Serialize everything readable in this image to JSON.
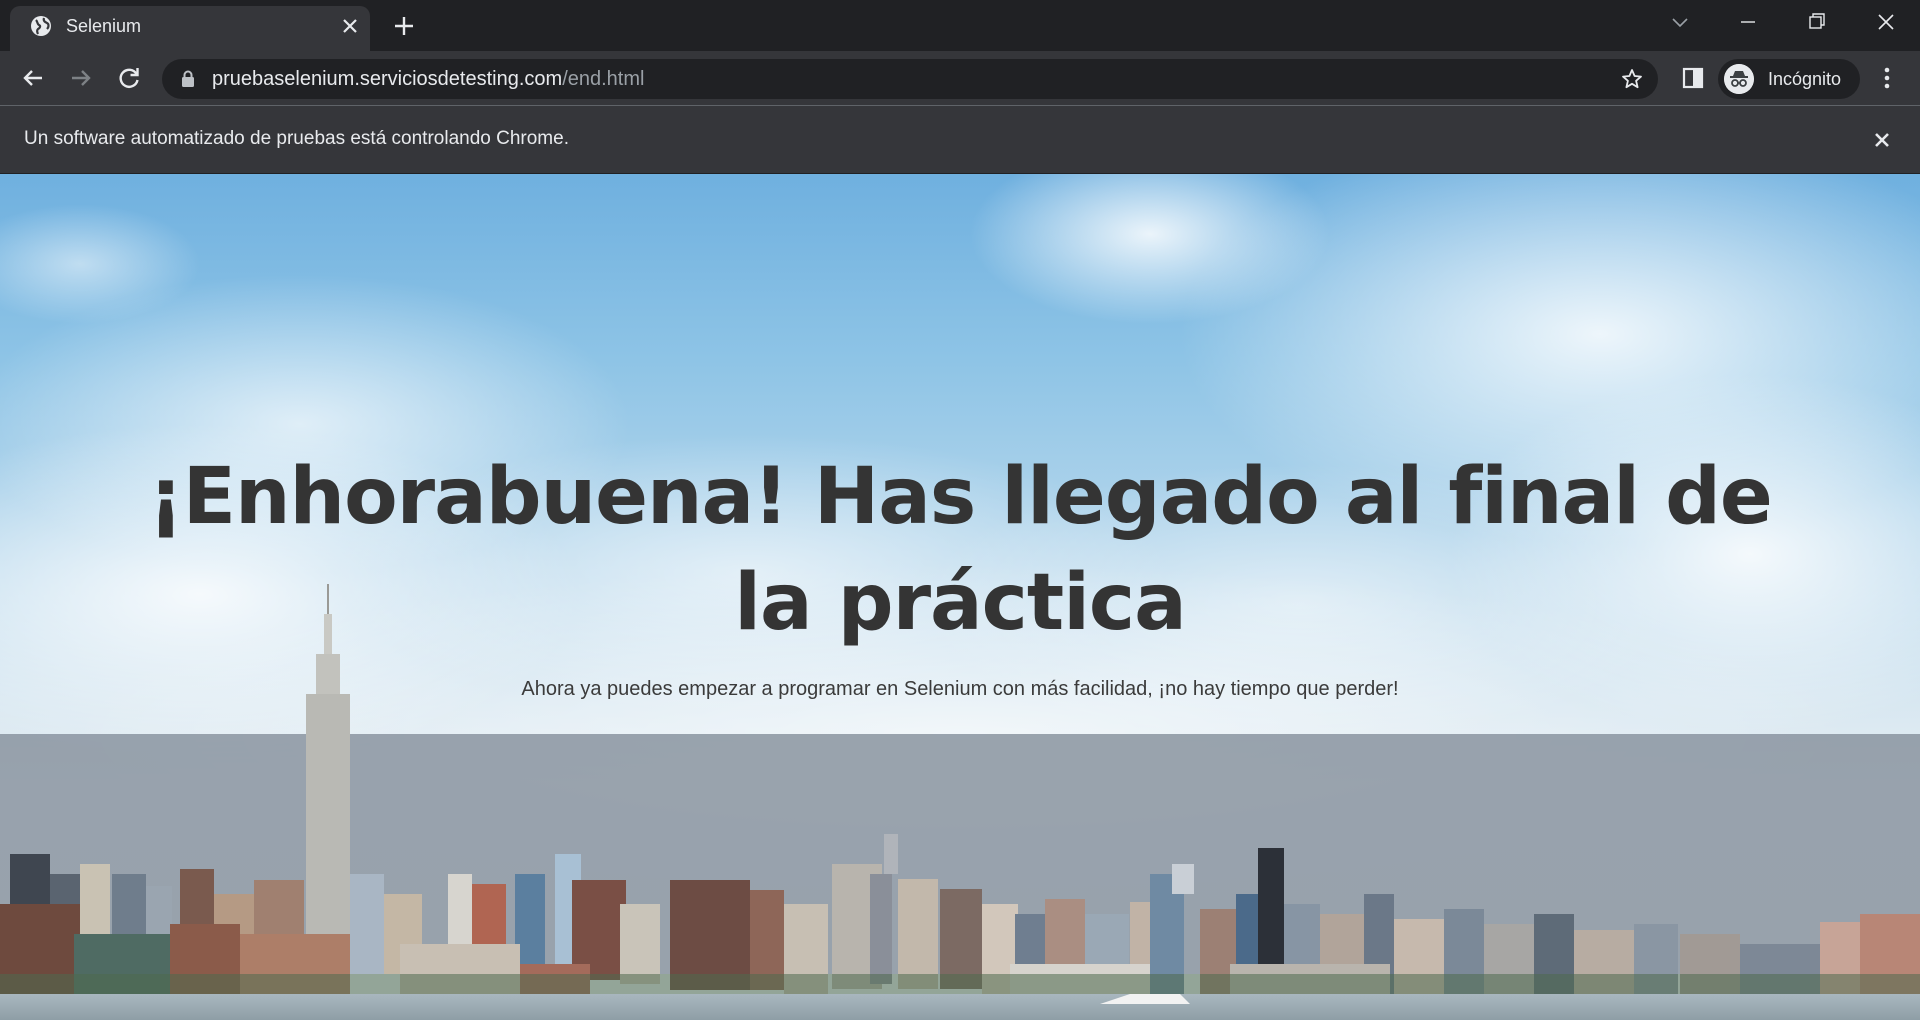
{
  "browser": {
    "tab": {
      "title": "Selenium",
      "favicon": "globe-icon"
    },
    "address_bar": {
      "host": "pruebaselenium.serviciosdetesting.com",
      "path": "/end.html"
    },
    "profile_label": "Incógnito"
  },
  "infobar": {
    "message": "Un software automatizado de pruebas está controlando Chrome."
  },
  "page": {
    "headline": "¡Enhorabuena! Has llegado al final de la práctica",
    "subtitle": "Ahora ya puedes empezar a programar en Selenium con más facilidad, ¡no hay tiempo que perder!"
  },
  "colors": {
    "chrome_dark": "#202124",
    "chrome_toolbar": "#35363a",
    "headline_text": "#343434",
    "sky_top": "#6fb0df"
  }
}
